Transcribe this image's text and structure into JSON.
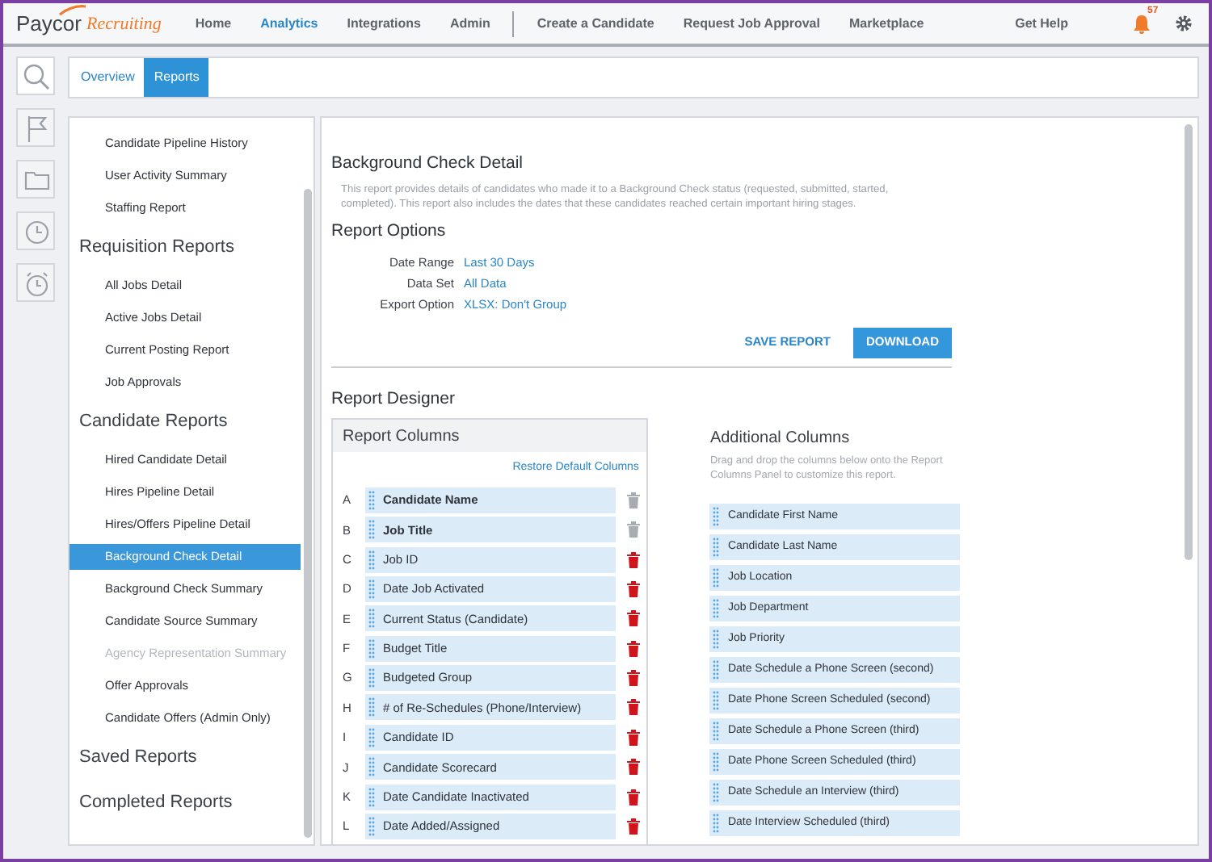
{
  "header": {
    "logo": {
      "brand": "Paycor",
      "product": "Recruiting"
    },
    "nav": [
      {
        "label": "Home",
        "selected": false,
        "separator_before": false
      },
      {
        "label": "Analytics",
        "selected": true,
        "separator_before": false
      },
      {
        "label": "Integrations",
        "selected": false,
        "separator_before": false
      },
      {
        "label": "Admin",
        "selected": false,
        "separator_before": false
      },
      {
        "label": "Create a Candidate",
        "selected": false,
        "separator_before": true
      },
      {
        "label": "Request Job Approval",
        "selected": false,
        "separator_before": false
      },
      {
        "label": "Marketplace",
        "selected": false,
        "separator_before": false
      }
    ],
    "help": "Get Help",
    "notifications": {
      "count": "57"
    }
  },
  "rail": [
    {
      "kind": "search",
      "selected": true
    },
    {
      "kind": "flag",
      "selected": false
    },
    {
      "kind": "folder",
      "selected": false
    },
    {
      "kind": "clock",
      "selected": false
    },
    {
      "kind": "alarm",
      "selected": false
    }
  ],
  "tabs": [
    {
      "label": "Overview",
      "selected": false
    },
    {
      "label": "Reports",
      "selected": true
    }
  ],
  "sidebar": {
    "groups": [
      {
        "items": [
          {
            "label": "Candidate Pipeline History",
            "selected": false,
            "disabled": false
          },
          {
            "label": "User Activity Summary",
            "selected": false,
            "disabled": false
          },
          {
            "label": "Staffing Report",
            "selected": false,
            "disabled": false
          }
        ]
      },
      {
        "title": "Requisition Reports",
        "items": [
          {
            "label": "All Jobs Detail",
            "selected": false,
            "disabled": false
          },
          {
            "label": "Active Jobs Detail",
            "selected": false,
            "disabled": false
          },
          {
            "label": "Current Posting Report",
            "selected": false,
            "disabled": false
          },
          {
            "label": "Job Approvals",
            "selected": false,
            "disabled": false
          }
        ]
      },
      {
        "title": "Candidate Reports",
        "items": [
          {
            "label": "Hired Candidate Detail",
            "selected": false,
            "disabled": false
          },
          {
            "label": "Hires Pipeline Detail",
            "selected": false,
            "disabled": false
          },
          {
            "label": "Hires/Offers Pipeline Detail",
            "selected": false,
            "disabled": false
          },
          {
            "label": "Background Check Detail",
            "selected": true,
            "disabled": false
          },
          {
            "label": "Background Check Summary",
            "selected": false,
            "disabled": false
          },
          {
            "label": "Candidate Source Summary",
            "selected": false,
            "disabled": false
          },
          {
            "label": "Agency Representation Summary",
            "selected": false,
            "disabled": true
          },
          {
            "label": "Offer Approvals",
            "selected": false,
            "disabled": false
          },
          {
            "label": "Candidate Offers (Admin Only)",
            "selected": false,
            "disabled": false
          }
        ]
      },
      {
        "title": "Saved Reports"
      },
      {
        "title": "Completed Reports"
      }
    ]
  },
  "report": {
    "title": "Background Check Detail",
    "description": "This report provides details of candidates who made it to a Background Check status (requested, submitted, started, completed). This report also includes the dates that these candidates reached certain important hiring stages.",
    "options_title": "Report Options",
    "options": [
      {
        "label": "Date Range",
        "value": "Last 30 Days"
      },
      {
        "label": "Data Set",
        "value": "All Data"
      },
      {
        "label": "Export Option",
        "value": "XLSX: Don't Group"
      }
    ],
    "save_button": "SAVE REPORT",
    "download_button": "DOWNLOAD",
    "designer_title": "Report Designer",
    "report_columns": {
      "title": "Report Columns",
      "restore_link": "Restore Default Columns",
      "rows": [
        {
          "letter": "A",
          "label": "Candidate Name",
          "locked": true
        },
        {
          "letter": "B",
          "label": "Job Title",
          "locked": true
        },
        {
          "letter": "C",
          "label": "Job ID",
          "locked": false
        },
        {
          "letter": "D",
          "label": "Date Job Activated",
          "locked": false
        },
        {
          "letter": "E",
          "label": "Current Status (Candidate)",
          "locked": false
        },
        {
          "letter": "F",
          "label": "Budget Title",
          "locked": false
        },
        {
          "letter": "G",
          "label": "Budgeted Group",
          "locked": false
        },
        {
          "letter": "H",
          "label": "# of Re-Schedules (Phone/Interview)",
          "locked": false
        },
        {
          "letter": "I",
          "label": "Candidate ID",
          "locked": false
        },
        {
          "letter": "J",
          "label": "Candidate Scorecard",
          "locked": false
        },
        {
          "letter": "K",
          "label": "Date Candidate Inactivated",
          "locked": false
        },
        {
          "letter": "L",
          "label": "Date Added/Assigned",
          "locked": false
        }
      ]
    },
    "additional_columns": {
      "title": "Additional Columns",
      "hint": "Drag and drop the columns below onto the Report Columns Panel to customize this report.",
      "items": [
        "Candidate First Name",
        "Candidate Last Name",
        "Job Location",
        "Job Department",
        "Job Priority",
        "Date Schedule a Phone Screen (second)",
        "Date Phone Screen Scheduled (second)",
        "Date Schedule a Phone Screen (third)",
        "Date Phone Screen Scheduled (third)",
        "Date Schedule an Interview (third)",
        "Date Interview Scheduled (third)"
      ]
    }
  }
}
